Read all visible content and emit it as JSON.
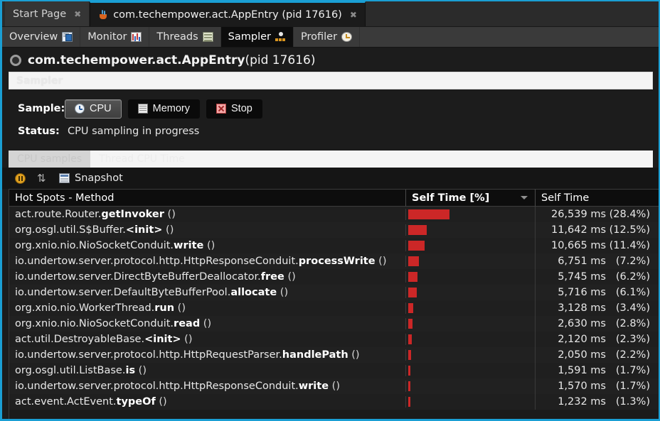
{
  "document_tabs": [
    {
      "label": "Start Page",
      "icon": "",
      "active": false,
      "closable": true
    },
    {
      "label": "com.techempower.act.AppEntry (pid 17616)",
      "icon": "java-icon",
      "active": true,
      "closable": true
    }
  ],
  "view_tabs": [
    {
      "label": "Overview",
      "icon": "overview-icon",
      "active": false
    },
    {
      "label": "Monitor",
      "icon": "monitor-icon",
      "active": false
    },
    {
      "label": "Threads",
      "icon": "threads-icon",
      "active": false
    },
    {
      "label": "Sampler",
      "icon": "sampler-icon",
      "active": true
    },
    {
      "label": "Profiler",
      "icon": "profiler-icon",
      "active": false
    }
  ],
  "app_title": {
    "name": "com.techempower.act.AppEntry",
    "pid": "(pid 17616)"
  },
  "sampler_strip": {
    "label": "Sampler"
  },
  "controls": {
    "sample_label": "Sample:",
    "buttons": [
      {
        "label": "CPU",
        "icon": "cpu-icon",
        "selected": true
      },
      {
        "label": "Memory",
        "icon": "memory-icon",
        "selected": false
      },
      {
        "label": "Stop",
        "icon": "stop-icon",
        "selected": false
      }
    ],
    "status_label": "Status:",
    "status_value": "CPU sampling in progress"
  },
  "inner_tabs": [
    {
      "label": "CPU samples",
      "active": true
    },
    {
      "label": "Thread CPU Time",
      "active": false
    }
  ],
  "toolbar": {
    "pause_icon": "pause-icon",
    "refresh_icon": "refresh-icon",
    "snapshot_icon": "snapshot-icon",
    "snapshot_label": "Snapshot"
  },
  "table": {
    "columns": [
      {
        "key": "method",
        "label": "Hot Spots - Method",
        "sorted": false
      },
      {
        "key": "self_pct",
        "label": "Self Time [%]",
        "sorted": true,
        "sort_dir": "desc"
      },
      {
        "key": "self_time",
        "label": "Self Time",
        "sorted": false
      }
    ],
    "bar_color": "#cc2727",
    "max_pct": 28.4,
    "rows": [
      {
        "package": "act.route.Router.",
        "method": "getInvoker",
        "args": "()",
        "pct": 28.4,
        "ms": "26,539 ms",
        "pct_text": "(28.4%)"
      },
      {
        "package": "org.osgl.util.S$Buffer.",
        "method": "<init>",
        "args": "()",
        "pct": 12.5,
        "ms": "11,642 ms",
        "pct_text": "(12.5%)"
      },
      {
        "package": "org.xnio.nio.NioSocketConduit.",
        "method": "write",
        "args": "()",
        "pct": 11.4,
        "ms": "10,665 ms",
        "pct_text": "(11.4%)"
      },
      {
        "package": "io.undertow.server.protocol.http.HttpResponseConduit.",
        "method": "processWrite",
        "args": "()",
        "pct": 7.2,
        "ms": "6,751 ms",
        "pct_text": "(7.2%)"
      },
      {
        "package": "io.undertow.server.DirectByteBufferDeallocator.",
        "method": "free",
        "args": "()",
        "pct": 6.2,
        "ms": "5,745 ms",
        "pct_text": "(6.2%)"
      },
      {
        "package": "io.undertow.server.DefaultByteBufferPool.",
        "method": "allocate",
        "args": "()",
        "pct": 6.1,
        "ms": "5,716 ms",
        "pct_text": "(6.1%)"
      },
      {
        "package": "org.xnio.nio.WorkerThread.",
        "method": "run",
        "args": "()",
        "pct": 3.4,
        "ms": "3,128 ms",
        "pct_text": "(3.4%)"
      },
      {
        "package": "org.xnio.nio.NioSocketConduit.",
        "method": "read",
        "args": "()",
        "pct": 2.8,
        "ms": "2,630 ms",
        "pct_text": "(2.8%)"
      },
      {
        "package": "act.util.DestroyableBase.",
        "method": "<init>",
        "args": "()",
        "pct": 2.3,
        "ms": "2,120 ms",
        "pct_text": "(2.3%)"
      },
      {
        "package": "io.undertow.server.protocol.http.HttpRequestParser.",
        "method": "handlePath",
        "args": "()",
        "pct": 2.2,
        "ms": "2,050 ms",
        "pct_text": "(2.2%)"
      },
      {
        "package": "org.osgl.util.ListBase.",
        "method": "is",
        "args": "()",
        "pct": 1.7,
        "ms": "1,591 ms",
        "pct_text": "(1.7%)"
      },
      {
        "package": "io.undertow.server.protocol.http.HttpResponseConduit.",
        "method": "write",
        "args": "()",
        "pct": 1.7,
        "ms": "1,570 ms",
        "pct_text": "(1.7%)"
      },
      {
        "package": "act.event.ActEvent.",
        "method": "typeOf",
        "args": "()",
        "pct": 1.3,
        "ms": "1,232 ms",
        "pct_text": "(1.3%)"
      }
    ]
  },
  "colors": {
    "accent_border": "#1a9fd4",
    "bar_red": "#cc2727",
    "panel_bg": "#1c1c1c",
    "tab_active_bg": "#0d0d0d"
  }
}
